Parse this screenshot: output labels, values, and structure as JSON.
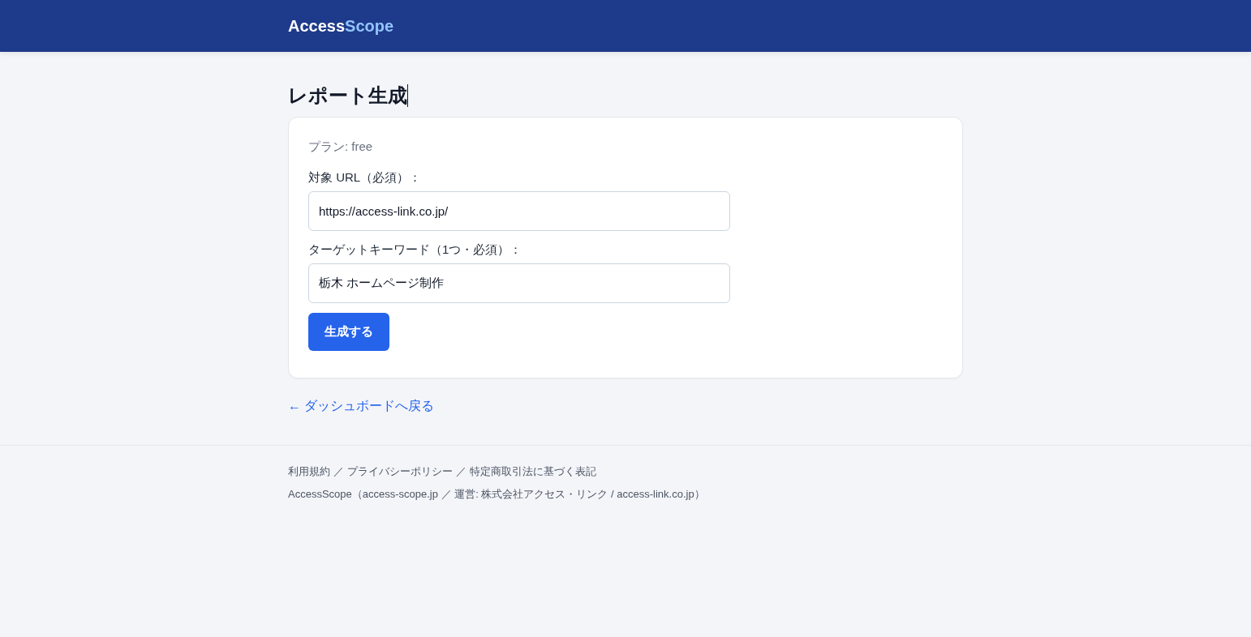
{
  "header": {
    "logo": [
      {
        "kind": "plain",
        "text": "Access"
      },
      {
        "kind": "accent",
        "text": "Scope"
      }
    ]
  },
  "page": {
    "title": "レポート生成"
  },
  "form": {
    "plan": "プラン: free",
    "fields": [
      {
        "label": "対象 URL（必須）：",
        "value": "https://access-link.co.jp/"
      },
      {
        "label": "ターゲットキーワード（1つ・必須）：",
        "value": "栃木 ホームページ制作"
      }
    ],
    "submit": "生成する"
  },
  "back_link": "← ダッシュボードへ戻る",
  "footer": {
    "links": [
      {
        "kind": "link",
        "text": "利用規約"
      },
      {
        "kind": "separator",
        "text": "／"
      },
      {
        "kind": "link",
        "text": "プライバシーポリシー"
      },
      {
        "kind": "separator",
        "text": "／"
      },
      {
        "kind": "link",
        "text": "特定商取引法に基づく表記"
      }
    ],
    "note": "AccessScope（access-scope.jp ／ 運営: 株式会社アクセス・リンク / access-link.co.jp）"
  }
}
